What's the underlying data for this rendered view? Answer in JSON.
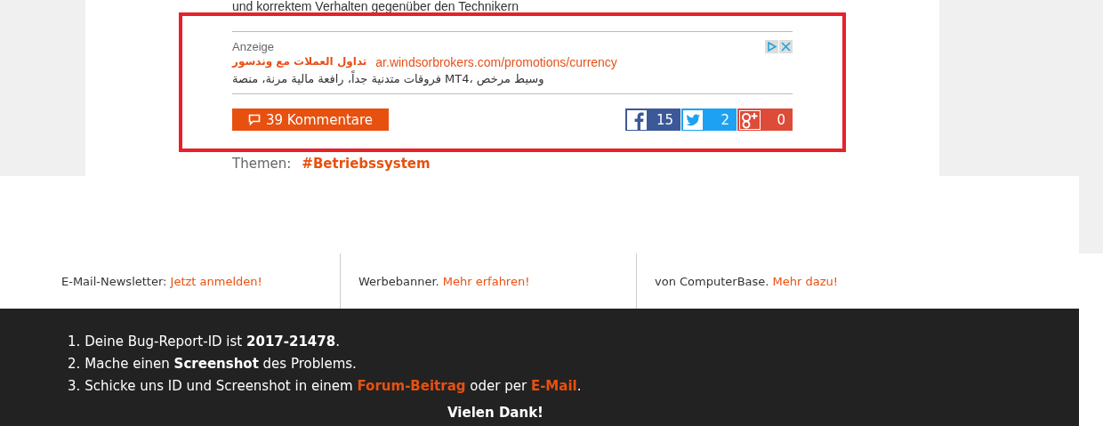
{
  "article": {
    "cut_line": "und korrektem Verhalten gegenüber den Technikern"
  },
  "ad": {
    "label": "Anzeige",
    "title": "تداول العملات مع وندسور",
    "url": "ar.windsorbrokers.com/promotions/currency",
    "text": "وسيط مرخص ،MT4 فروقات متدنية جداً، رافعة مالية مرنة، منصة"
  },
  "comments_button": "39 Kommentare",
  "shares": [
    {
      "kind": "facebook",
      "count": "15"
    },
    {
      "kind": "twitter",
      "count": "2"
    },
    {
      "kind": "googleplus",
      "count": "0"
    }
  ],
  "topics": {
    "label": "Themen:",
    "tags": [
      "#Betriebssystem"
    ]
  },
  "footer_columns": [
    {
      "text": "E-Mail-Newsletter:",
      "link": "Jetzt anmelden!"
    },
    {
      "text": "Werbebanner.",
      "link": "Mehr erfahren!"
    },
    {
      "text": "von ComputerBase.",
      "link": "Mehr dazu!"
    }
  ],
  "bug_report": {
    "steps": [
      {
        "number": "1.",
        "text": "Deine Bug-Report-ID ist **2017-21478**."
      },
      {
        "number": "2.",
        "text": "Mache einen **Screenshot** des Problems."
      },
      {
        "number": "3.",
        "text": "Schicke uns ID und Screenshot in einem",
        "links": [
          "Forum-Beitrag",
          "E-Mail"
        ],
        "joiner": "oder per",
        "end": "."
      }
    ],
    "thanks": "Vielen Dank!"
  }
}
